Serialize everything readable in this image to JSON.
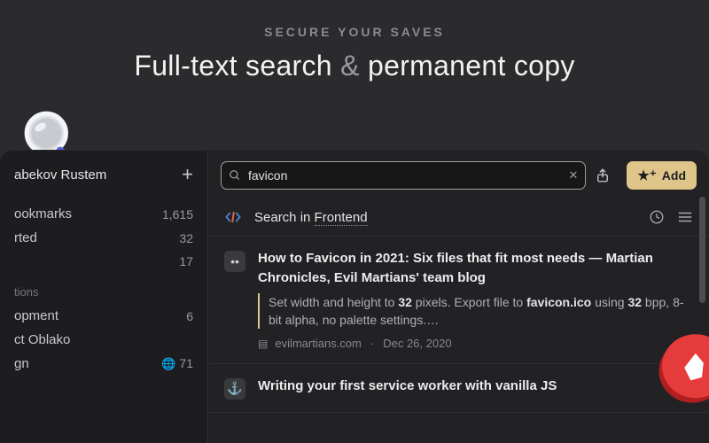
{
  "hero": {
    "eyebrow": "SECURE YOUR SAVES",
    "headline_a": "Full-text search",
    "headline_amp": "&",
    "headline_b": "permanent copy"
  },
  "sidebar": {
    "user_name": "abekov Rustem",
    "items_primary": [
      {
        "label": "ookmarks",
        "count": "1,615"
      },
      {
        "label": "rted",
        "count": "32"
      },
      {
        "label": "",
        "count": "17"
      }
    ],
    "group_label": "tions",
    "items_collections": [
      {
        "label": "opment",
        "count": "6"
      },
      {
        "label": "ct Oblako",
        "count": ""
      },
      {
        "label": "gn",
        "count": "71",
        "globe": true
      }
    ]
  },
  "toolbar": {
    "search_value": "favicon",
    "add_label": "Add"
  },
  "context": {
    "prefix": "Search in ",
    "scope": "Frontend"
  },
  "results": [
    {
      "title": "How to Favicon in 2021: Six files that fit most needs — Martian Chronicles, Evil Martians' team blog",
      "snippet_html": "Set width and height to <b>32</b> pixels. Export file to <b>favicon.ico</b> using <b>32</b> bpp, 8-bit alpha, no palette settings.…",
      "domain": "evilmartians.com",
      "date": "Dec 26, 2020",
      "favicon_glyph": "••"
    },
    {
      "title": "Writing your first service worker with vanilla JS",
      "favicon_glyph": "⚓"
    }
  ]
}
